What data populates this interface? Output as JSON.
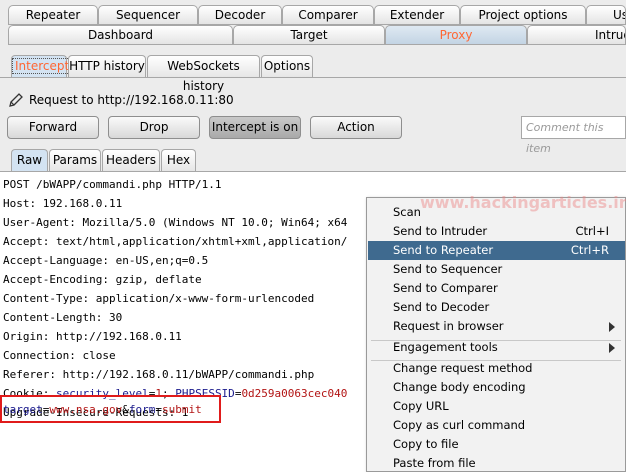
{
  "top_tabs_row1": [
    "Repeater",
    "Sequencer",
    "Decoder",
    "Comparer",
    "Extender",
    "Project options",
    "Us"
  ],
  "top_tabs_row2": [
    "Dashboard",
    "Target",
    "Proxy",
    "Intrude"
  ],
  "proxy_tabs": [
    "Intercept",
    "HTTP history",
    "WebSockets history",
    "Options"
  ],
  "request_to": "Request to http://192.168.0.11:80",
  "buttons": {
    "forward": "Forward",
    "drop": "Drop",
    "intercept": "Intercept is on",
    "action": "Action"
  },
  "comment_placeholder": "Comment this item",
  "view_tabs": [
    "Raw",
    "Params",
    "Headers",
    "Hex"
  ],
  "request_lines": [
    "POST /bWAPP/commandi.php HTTP/1.1",
    "Host: 192.168.0.11",
    "User-Agent: Mozilla/5.0 (Windows NT 10.0; Win64; x64",
    "Accept: text/html,application/xhtml+xml,application/",
    "Accept-Language: en-US,en;q=0.5",
    "Accept-Encoding: gzip, deflate",
    "Content-Type: application/x-www-form-urlencoded",
    "Content-Length: 30",
    "Origin: http://192.168.0.11",
    "Connection: close",
    "Referer: http://192.168.0.11/bWAPP/commandi.php"
  ],
  "cookie": {
    "prefix": "Cookie: ",
    "k1": "security_level",
    "eq1": "=",
    "v1": "1",
    "sep": "; ",
    "k2": "PHPSESSID",
    "eq2": "=",
    "v2": "0d259a0063cec040"
  },
  "upgrade_line": "Upgrade-Insecure-Requests: 1",
  "body": {
    "k1": "target",
    "eq1": "=",
    "v1": "www.nsa.gov",
    "amp": "&",
    "k2": "form",
    "eq2": "=",
    "v2": "submit"
  },
  "watermark": "www.hackingarticles.in",
  "context_menu": [
    {
      "label": "Scan",
      "shortcut": ""
    },
    {
      "label": "Send to Intruder",
      "shortcut": "Ctrl+I"
    },
    {
      "label": "Send to Repeater",
      "shortcut": "Ctrl+R"
    },
    {
      "label": "Send to Sequencer",
      "shortcut": ""
    },
    {
      "label": "Send to Comparer",
      "shortcut": ""
    },
    {
      "label": "Send to Decoder",
      "shortcut": ""
    },
    {
      "label": "Request in browser",
      "shortcut": ""
    },
    {
      "label": "Engagement tools",
      "shortcut": ""
    },
    {
      "label": "Change request method",
      "shortcut": ""
    },
    {
      "label": "Change body encoding",
      "shortcut": ""
    },
    {
      "label": "Copy URL",
      "shortcut": ""
    },
    {
      "label": "Copy as curl command",
      "shortcut": ""
    },
    {
      "label": "Copy to file",
      "shortcut": ""
    },
    {
      "label": "Paste from file",
      "shortcut": ""
    }
  ],
  "colors": {
    "accent": "#ff6633",
    "menu_selected": "#3f6a8f",
    "highlight_border": "#e01b1b"
  }
}
